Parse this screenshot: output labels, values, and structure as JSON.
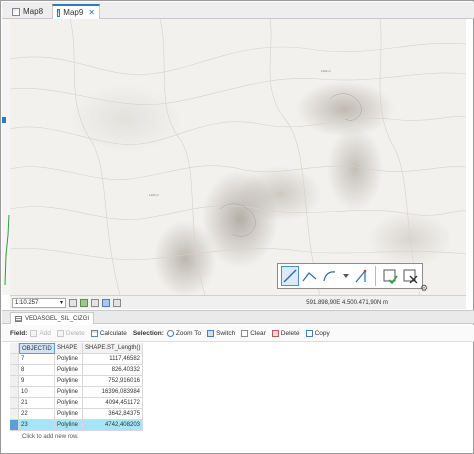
{
  "tabs": [
    {
      "label": "Map8",
      "active": false
    },
    {
      "label": "Map9",
      "active": true,
      "close": "✕"
    }
  ],
  "map": {
    "elevation_labels": [
      "1100 m",
      "1100 m"
    ]
  },
  "edit_toolbar": {
    "tools": [
      "line-icon",
      "polyline-icon",
      "arc-icon",
      "right-angle-icon",
      "finish-sketch-icon",
      "cancel-sketch-icon"
    ]
  },
  "statusbar": {
    "scale": "1:10.257",
    "coordinates": "591.898,90E 4.500.471,90N m"
  },
  "attribute_table": {
    "tab_label": "VEDASGEL_SIL_CIZGI",
    "toolbar": {
      "field_label": "Field:",
      "add": "Add",
      "delete": "Delete",
      "calculate": "Calculate",
      "selection_label": "Selection:",
      "zoom_to": "Zoom To",
      "switch": "Switch",
      "clear": "Clear",
      "delete_sel": "Delete",
      "copy": "Copy"
    },
    "columns": [
      "OBJECTID",
      "SHAPE",
      "SHAPE.ST_Length()"
    ],
    "rows": [
      {
        "id": "7",
        "shape": "Polyline",
        "length": "1117,46582"
      },
      {
        "id": "8",
        "shape": "Polyline",
        "length": "826,40332"
      },
      {
        "id": "9",
        "shape": "Polyline",
        "length": "752,916016"
      },
      {
        "id": "10",
        "shape": "Polyline",
        "length": "16396,083984"
      },
      {
        "id": "21",
        "shape": "Polyline",
        "length": "4094,451172"
      },
      {
        "id": "22",
        "shape": "Polyline",
        "length": "3642,84375"
      },
      {
        "id": "23",
        "shape": "Polyline",
        "length": "4742,408203",
        "selected": true
      }
    ],
    "add_row_text": "Click to add new row."
  }
}
